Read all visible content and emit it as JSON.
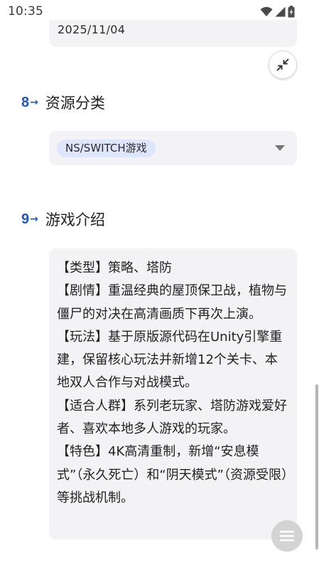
{
  "status_bar": {
    "time": "10:35"
  },
  "date_field": {
    "value": "2025/11/04"
  },
  "collapse_button": {
    "icon": "collapse-icon"
  },
  "sections": [
    {
      "number": "8",
      "arrow": "→",
      "title": "资源分类"
    },
    {
      "number": "9",
      "arrow": "→",
      "title": "游戏介绍"
    }
  ],
  "category_select": {
    "selected": "NS/SWITCH游戏",
    "icon": "dropdown-caret-icon"
  },
  "game_intro": {
    "text": "【类型】策略、塔防\n【剧情】重温经典的屋顶保卫战，植物与僵尸的对决在高清画质下再次上演。\n【玩法】基于原版源代码在Unity引擎重建，保留核心玩法并新增12个关卡、本地双人合作与对战模式。\n【适合人群】系列老玩家、塔防游戏爱好者、喜欢本地多人游戏的玩家。\n【特色】4K高清重制，新增“安息模式”（永久死亡）和“阴天模式”（资源受限）等挑战机制。"
  },
  "colors": {
    "accent": "#1a56c4",
    "card_bg": "#f3f3f5",
    "chip_bg": "#dde6fb"
  }
}
